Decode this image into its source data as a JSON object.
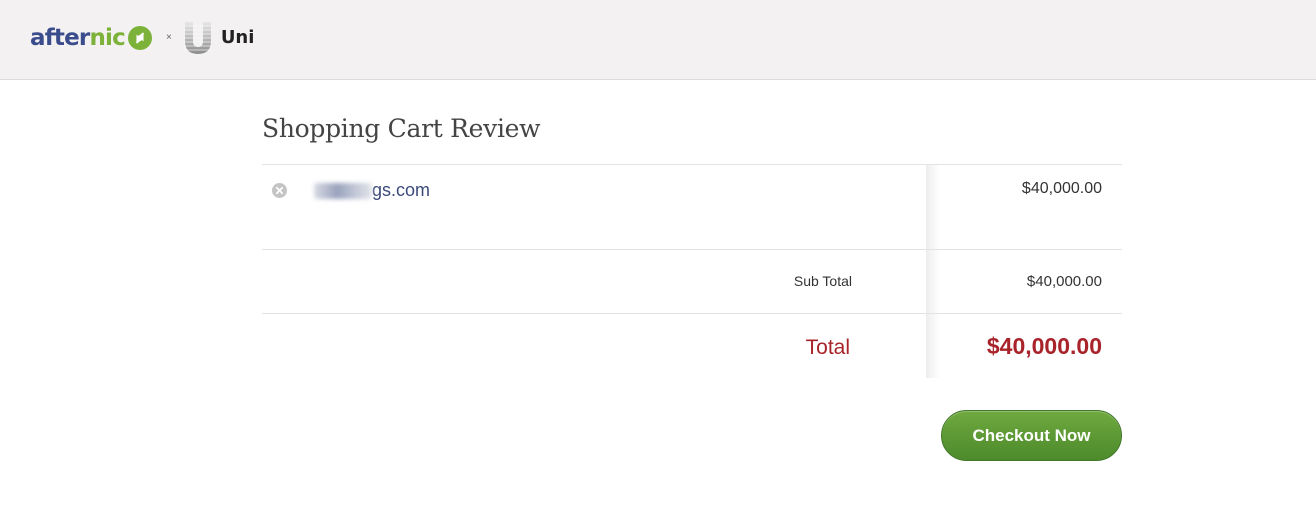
{
  "header": {
    "brand_part1": "after",
    "brand_part2": "nic",
    "separator": "×",
    "partner_name": "Uni"
  },
  "page_title": "Shopping Cart Review",
  "cart": {
    "items": [
      {
        "domain_suffix": "gs.com",
        "price": "$40,000.00"
      }
    ],
    "subtotal_label": "Sub Total",
    "subtotal_value": "$40,000.00",
    "total_label": "Total",
    "total_value": "$40,000.00"
  },
  "actions": {
    "checkout_label": "Checkout Now"
  },
  "colors": {
    "header_bg": "#f3f1f2",
    "brand_blue": "#3b4c8c",
    "brand_green": "#7cb23a",
    "total_red": "#a8232a",
    "checkout_green": "#5a9a33"
  }
}
